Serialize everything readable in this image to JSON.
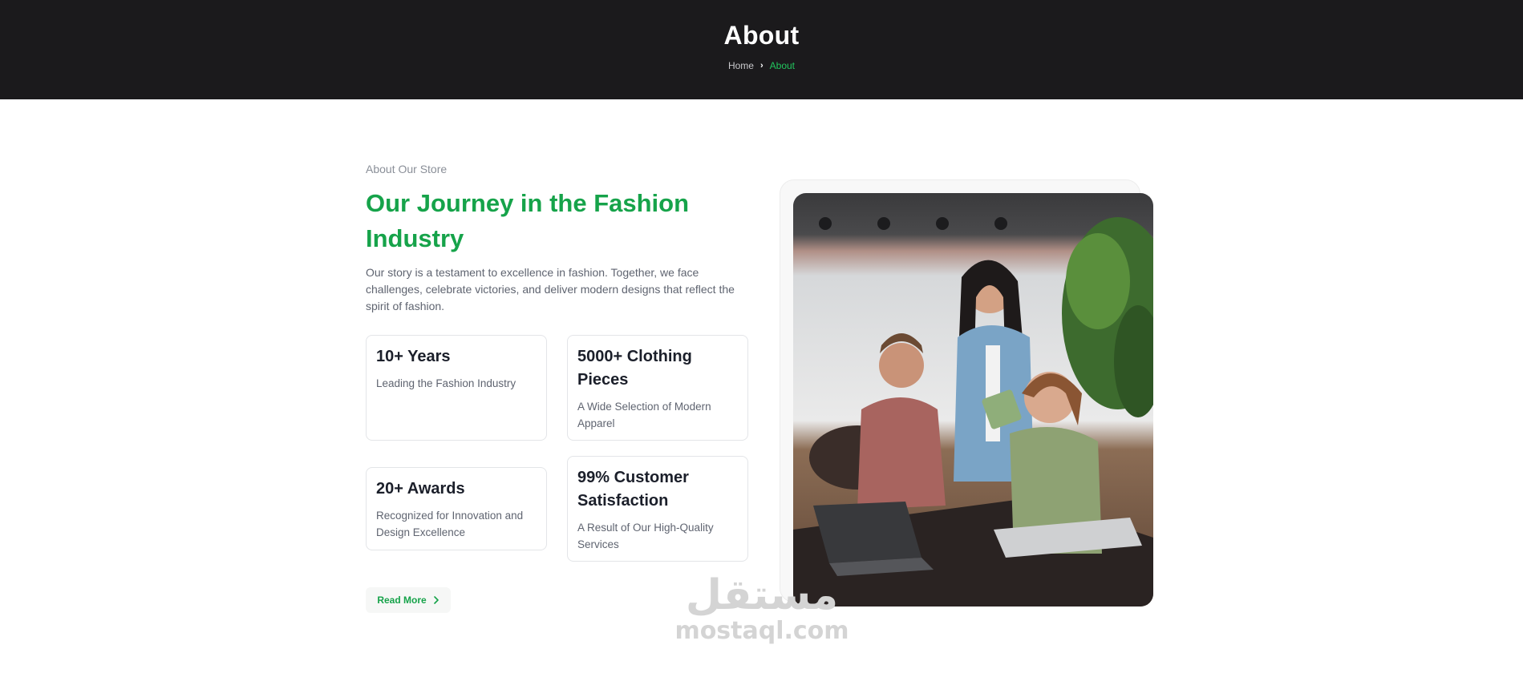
{
  "header": {
    "title": "About",
    "breadcrumb": {
      "home": "Home",
      "separator": "›",
      "current": "About"
    }
  },
  "about": {
    "eyebrow": "About Our Store",
    "headline": "Our Journey in the Fashion Industry",
    "intro": "Our story is a testament to excellence in fashion. Together, we face challenges, celebrate victories, and deliver modern designs that reflect the spirit of fashion.",
    "stats": [
      {
        "value": "10+ Years",
        "description": "Leading the Fashion Industry"
      },
      {
        "value": "5000+ Clothing Pieces",
        "description": "A Wide Selection of Modern Apparel"
      },
      {
        "value": "20+ Awards",
        "description": "Recognized for Innovation and Design Excellence"
      },
      {
        "value": "99% Customer Satisfaction",
        "description": "A Result of Our High-Quality Services"
      }
    ],
    "read_more_label": "Read More",
    "image_subject": "team-collaborating-at-laptop-photo"
  },
  "watermark": {
    "arabic": "مستقل",
    "latin": "mostaql.com"
  },
  "colors": {
    "hero_bg": "#1b1a1c",
    "accent": "#16a34a",
    "breadcrumb_active": "#22c55e",
    "muted_text": "#5f6470"
  }
}
